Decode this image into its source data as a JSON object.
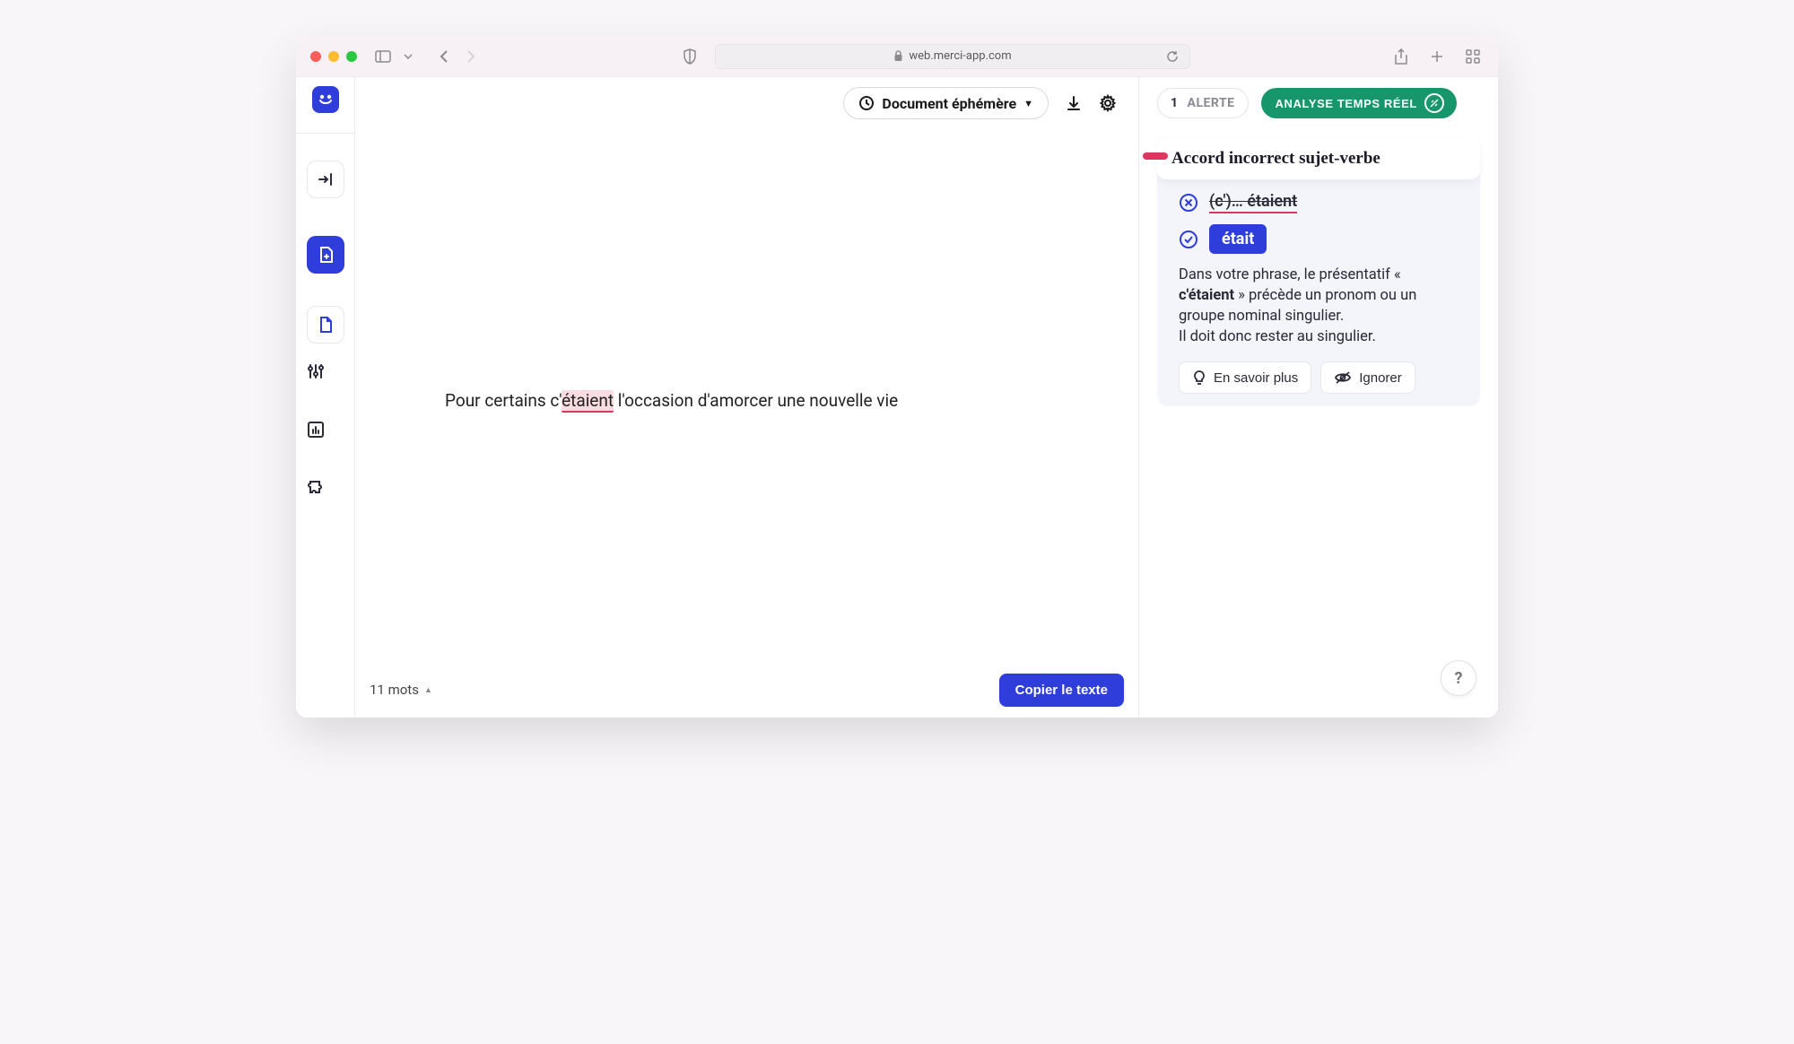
{
  "titlebar": {
    "domain": "web.merci-app.com"
  },
  "toolbar": {
    "doc_label": "Document éphémère"
  },
  "editor": {
    "pre": "Pour certains c'",
    "err": "étaient",
    "post": " l'occasion d'amorcer une nouvelle vie"
  },
  "status": {
    "wordcount": "11 mots",
    "copy_label": "Copier le texte"
  },
  "right": {
    "alert_count": "1",
    "alert_label": "ALERTE",
    "analyse_label": "ANALYSE TEMPS RÉEL"
  },
  "card": {
    "title": "Accord incorrect sujet-verbe",
    "wrong_text": "(c')… étaient",
    "right_text": "était",
    "explain_pre": "Dans votre phrase, le présentatif « ",
    "explain_bold": "c'étaient",
    "explain_post": " » précède un pronom ou un groupe nominal singulier.",
    "explain_line2": "Il doit donc rester au singulier.",
    "learn_more": "En savoir plus",
    "ignore": "Ignorer"
  },
  "help": {
    "label": "?"
  }
}
